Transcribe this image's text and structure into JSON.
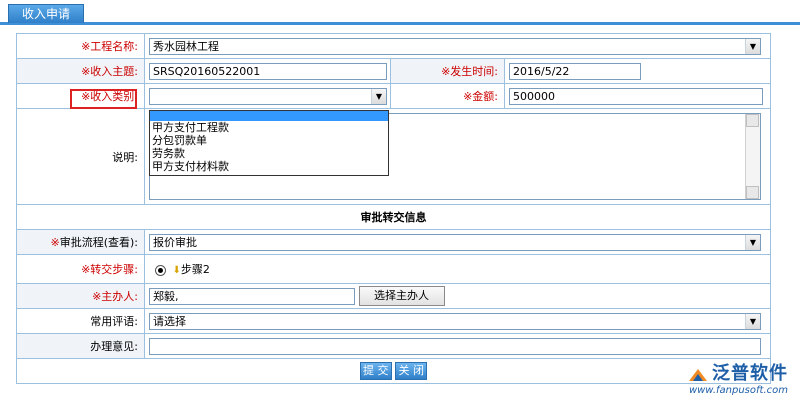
{
  "tab": {
    "label": "收入申请"
  },
  "form": {
    "project_name": {
      "label": "工程名称:",
      "value": "秀水园林工程"
    },
    "income_subject": {
      "label": "收入主题:",
      "value": "SRSQ20160522001"
    },
    "occur_time": {
      "label": "发生时间:",
      "value": "2016/5/22"
    },
    "income_category": {
      "label": "收入类别:",
      "value": ""
    },
    "amount": {
      "label": "金额:",
      "value": "500000"
    },
    "description": {
      "label": "说明:",
      "value": ""
    },
    "required_mark": "※"
  },
  "category_dropdown": {
    "options": [
      "",
      "甲方支付工程款",
      "分包罚款单",
      "劳务款",
      "甲方支付材料款"
    ]
  },
  "approval": {
    "section_title": "审批转交信息",
    "flow": {
      "label": "审批流程(查看):",
      "value": "报价审批"
    },
    "step": {
      "label": "转交步骤:",
      "value": "步骤2"
    },
    "handler": {
      "label": "主办人:",
      "value": "郑毅,",
      "button": "选择主办人"
    },
    "common_comment": {
      "label": "常用评语:",
      "value": "请选择"
    },
    "opinion": {
      "label": "办理意见:",
      "value": ""
    }
  },
  "actions": {
    "submit": "提 交",
    "close": "关 闭"
  },
  "brand": {
    "name": "泛普软件",
    "url": "www.fanpusoft.com",
    "color": "#1f5fa8"
  }
}
